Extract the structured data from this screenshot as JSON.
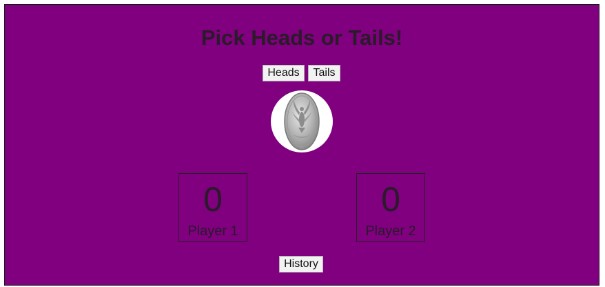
{
  "page": {
    "title": "Pick Heads or Tails!"
  },
  "choices": {
    "heads_label": "Heads",
    "tails_label": "Tails"
  },
  "coin": {
    "icon": "coin-eagle-icon"
  },
  "players": [
    {
      "score": "0",
      "label": "Player 1"
    },
    {
      "score": "0",
      "label": "Player 2"
    }
  ],
  "footer": {
    "history_label": "History"
  },
  "colors": {
    "background": "#800080",
    "text": "#2a1a2a"
  }
}
